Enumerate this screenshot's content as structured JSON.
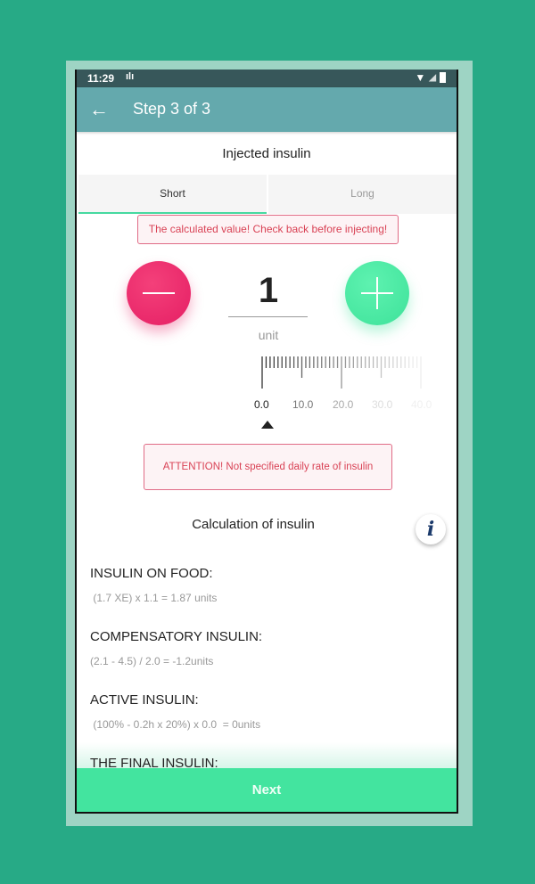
{
  "status_bar": {
    "time": "11:29",
    "vibrate_icon": "vibrate-icon",
    "wifi_icon": "wifi-icon",
    "signal_icon": "signal-icon",
    "battery_icon": "battery-charging-icon"
  },
  "app_bar": {
    "back_icon": "arrow-left-icon",
    "title": "Step 3 of 3"
  },
  "section_title": "Injected insulin",
  "tabs": [
    {
      "label": "Short",
      "active": true
    },
    {
      "label": "Long",
      "active": false
    }
  ],
  "warning_calculated": "The calculated value! Check back before injecting!",
  "dose": {
    "value": "1",
    "unit": "unit",
    "minus_icon": "minus-icon",
    "plus_icon": "plus-icon"
  },
  "ruler": {
    "labels": [
      "0.0",
      "10.0",
      "20.0",
      "30.0",
      "40.0"
    ],
    "selected": 0.0
  },
  "warning_daily": "ATTENTION! Not specified daily rate of insulin",
  "calculation": {
    "title": "Calculation of insulin",
    "info_icon": "info-icon",
    "items": [
      {
        "heading": "INSULIN ON FOOD:",
        "formula": " (1.7 XE) x 1.1 = 1.87 units"
      },
      {
        "heading": "COMPENSATORY INSULIN:",
        "formula": "(2.1 - 4.5) / 2.0 = -1.2units"
      },
      {
        "heading": "ACTIVE INSULIN:",
        "formula": " (100% - 0.2h x 20%) x 0.0  = 0units"
      },
      {
        "heading": "THE FINAL INSULIN:",
        "formula": ""
      }
    ]
  },
  "next_button": "Next"
}
